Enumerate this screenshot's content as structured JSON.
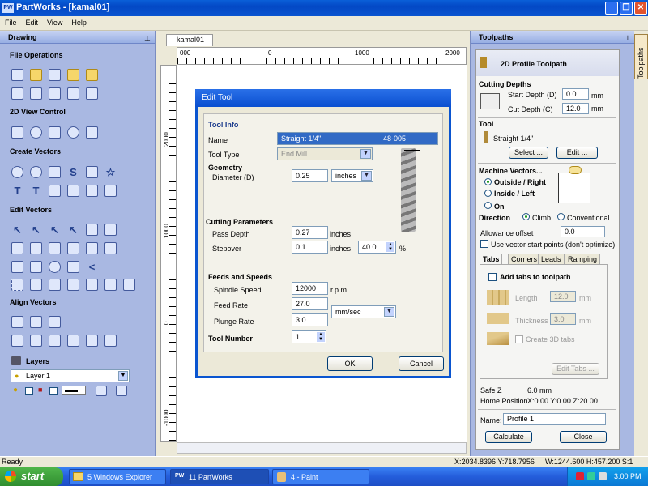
{
  "window": {
    "title": "PartWorks - [kamal01]",
    "app_icon": "PW"
  },
  "menu": [
    "File",
    "Edit",
    "View",
    "Help"
  ],
  "left_panel": {
    "title": "Drawing",
    "sections": {
      "file_ops": "File Operations",
      "view_control": "2D View Control",
      "create_vectors": "Create Vectors",
      "edit_vectors": "Edit Vectors",
      "align_vectors": "Align Vectors",
      "layers": "Layers"
    },
    "layer_selected": "Layer 1"
  },
  "document": {
    "tab": "kamal01",
    "hruler": [
      "000",
      "0",
      "1000",
      "2000"
    ],
    "vruler": [
      "2000",
      "1000",
      "0",
      "-1000"
    ]
  },
  "edit_tool": {
    "title": "Edit Tool",
    "tool_info": "Tool Info",
    "name_label": "Name",
    "name_value": "Straight 1/4\"",
    "name_code": "48-005",
    "tool_type_label": "Tool Type",
    "tool_type_value": "End Mill",
    "geometry": "Geometry",
    "diameter_label": "Diameter (D)",
    "diameter_value": "0.25",
    "diameter_units": "inches",
    "cutting_params": "Cutting Parameters",
    "pass_depth_label": "Pass Depth",
    "pass_depth_value": "0.27",
    "pass_depth_units": "inches",
    "stepover_label": "Stepover",
    "stepover_value": "0.1",
    "stepover_units": "inches",
    "stepover_pct": "40.0",
    "pct_sign": "%",
    "feeds_speeds": "Feeds and Speeds",
    "spindle_label": "Spindle Speed",
    "spindle_value": "12000",
    "spindle_units": "r.p.m",
    "feed_label": "Feed Rate",
    "feed_value": "27.0",
    "feed_units": "mm/sec",
    "plunge_label": "Plunge Rate",
    "plunge_value": "3.0",
    "tool_number_label": "Tool Number",
    "tool_number_value": "1",
    "ok": "OK",
    "cancel": "Cancel"
  },
  "toolpaths": {
    "title": "Toolpaths",
    "vtab": "Toolpaths",
    "header": "2D Profile Toolpath",
    "cutting_depths": "Cutting Depths",
    "start_depth_label": "Start Depth (D)",
    "start_depth_value": "0.0",
    "cut_depth_label": "Cut Depth (C)",
    "cut_depth_value": "12.0",
    "mm": "mm",
    "tool": "Tool",
    "tool_name": "Straight 1/4\"",
    "select_btn": "Select ...",
    "edit_btn": "Edit ...",
    "machine_vectors": "Machine Vectors...",
    "outside_right": "Outside / Right",
    "inside_left": "Inside / Left",
    "on": "On",
    "direction": "Direction",
    "climb": "Climb",
    "conventional": "Conventional",
    "allowance_label": "Allowance offset",
    "allowance_value": "0.0",
    "use_vector_start": "Use vector start points (don't optimize)",
    "tabs": [
      "Tabs",
      "Corners",
      "Leads",
      "Ramping"
    ],
    "add_tabs": "Add tabs to toolpath",
    "length_label": "Length",
    "length_value": "12.0",
    "thickness_label": "Thickness",
    "thickness_value": "3.0",
    "create_3d_tabs": "Create 3D tabs",
    "edit_tabs_btn": "Edit Tabs ...",
    "safe_z_label": "Safe Z",
    "safe_z_value": "6.0 mm",
    "home_label": "Home Position",
    "home_value": "X:0.00 Y:0.00 Z:20.00",
    "name_label": "Name:",
    "name_value": "Profile 1",
    "calculate": "Calculate",
    "close": "Close"
  },
  "status": {
    "left": "Ready",
    "coords": "X:2034.8396 Y:718.7956",
    "size": "W:1244.600  H:457.200  S:1"
  },
  "taskbar": {
    "start": "start",
    "tasks": [
      "5 Windows Explorer",
      "11 PartWorks",
      "4 - Paint"
    ],
    "time": "3:00 PM"
  },
  "colors": {
    "xp_blue": "#0a55d0",
    "panel_blue": "#a9b8e2",
    "start_green": "#3a9d35"
  }
}
